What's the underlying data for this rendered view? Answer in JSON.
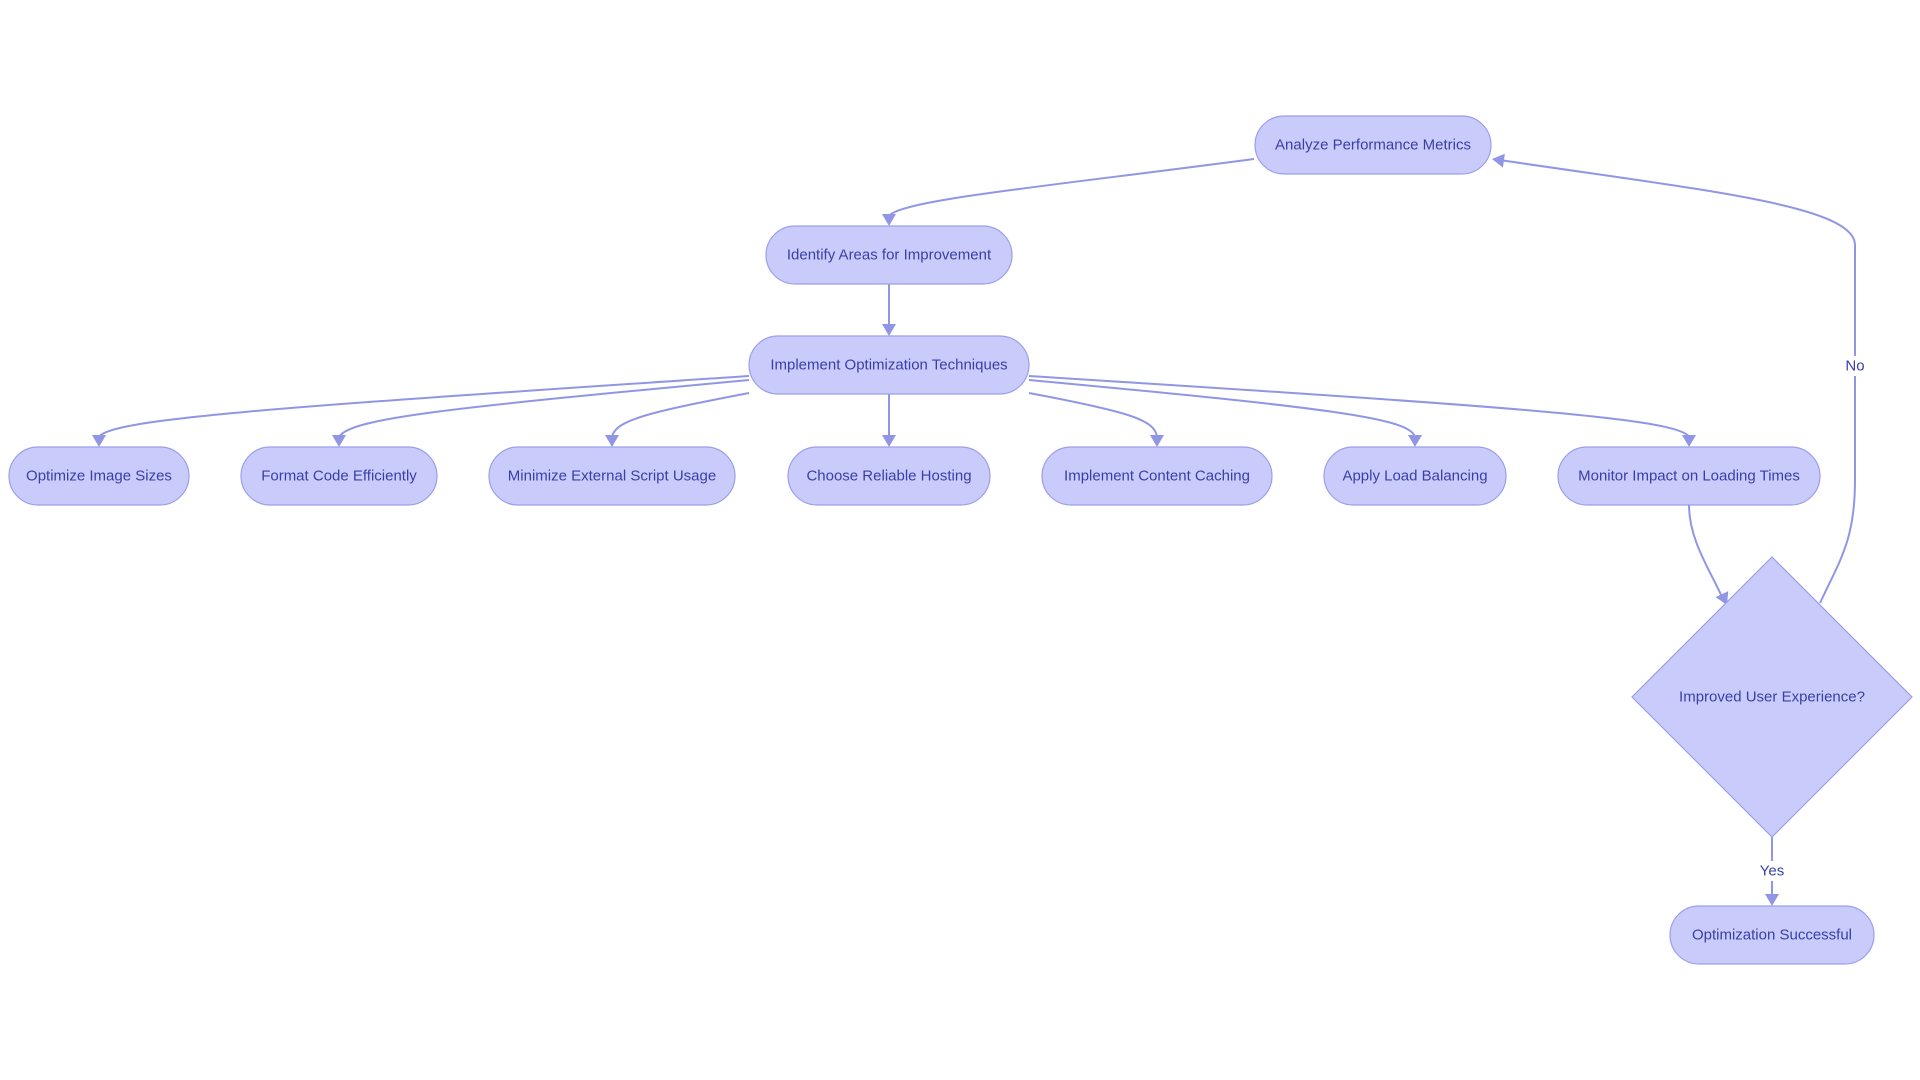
{
  "diagram": {
    "type": "flowchart",
    "colors": {
      "node_fill": "#c9cbfb",
      "node_stroke": "#9b9fea",
      "edge": "#9196e4",
      "text": "#3a3fa8",
      "background": "#ffffff"
    },
    "nodes": [
      {
        "id": "analyze",
        "label": "Analyze Performance Metrics",
        "shape": "stadium"
      },
      {
        "id": "identify",
        "label": "Identify Areas for Improvement",
        "shape": "stadium"
      },
      {
        "id": "implement",
        "label": "Implement Optimization Techniques",
        "shape": "stadium"
      },
      {
        "id": "optimize_images",
        "label": "Optimize Image Sizes",
        "shape": "stadium"
      },
      {
        "id": "format_code",
        "label": "Format Code Efficiently",
        "shape": "stadium"
      },
      {
        "id": "minimize_scripts",
        "label": "Minimize External Script Usage",
        "shape": "stadium"
      },
      {
        "id": "hosting",
        "label": "Choose Reliable Hosting",
        "shape": "stadium"
      },
      {
        "id": "caching",
        "label": "Implement Content Caching",
        "shape": "stadium"
      },
      {
        "id": "load_balancing",
        "label": "Apply Load Balancing",
        "shape": "stadium"
      },
      {
        "id": "monitor",
        "label": "Monitor Impact on Loading Times",
        "shape": "stadium"
      },
      {
        "id": "decision",
        "label": "Improved User Experience?",
        "shape": "diamond"
      },
      {
        "id": "success",
        "label": "Optimization Successful",
        "shape": "stadium"
      }
    ],
    "edges": [
      {
        "from": "analyze",
        "to": "identify",
        "label": ""
      },
      {
        "from": "identify",
        "to": "implement",
        "label": ""
      },
      {
        "from": "implement",
        "to": "optimize_images",
        "label": ""
      },
      {
        "from": "implement",
        "to": "format_code",
        "label": ""
      },
      {
        "from": "implement",
        "to": "minimize_scripts",
        "label": ""
      },
      {
        "from": "implement",
        "to": "hosting",
        "label": ""
      },
      {
        "from": "implement",
        "to": "caching",
        "label": ""
      },
      {
        "from": "implement",
        "to": "load_balancing",
        "label": ""
      },
      {
        "from": "implement",
        "to": "monitor",
        "label": ""
      },
      {
        "from": "monitor",
        "to": "decision",
        "label": ""
      },
      {
        "from": "decision",
        "to": "success",
        "label": "Yes"
      },
      {
        "from": "decision",
        "to": "analyze",
        "label": "No"
      }
    ]
  }
}
